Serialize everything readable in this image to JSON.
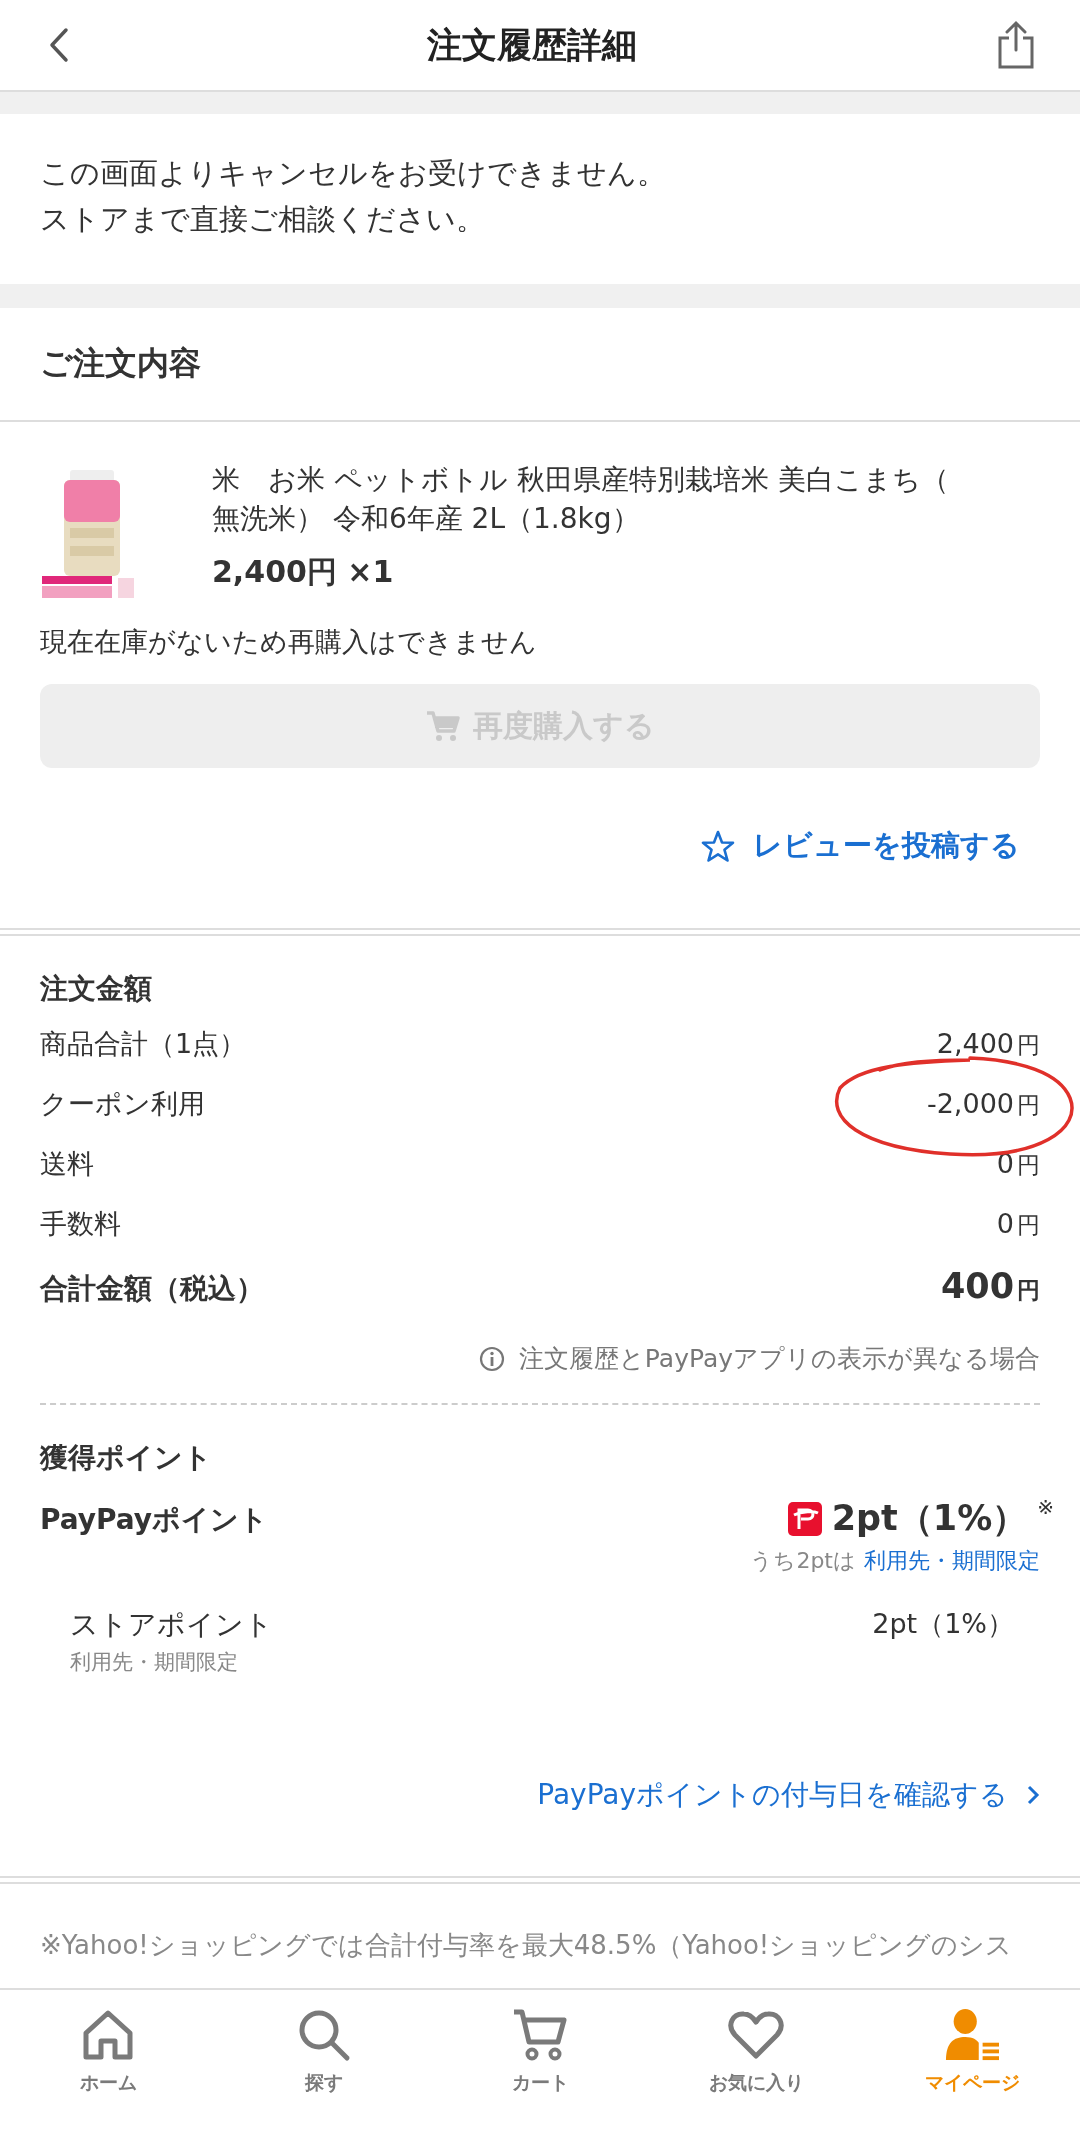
{
  "header": {
    "title": "注文履歴詳細"
  },
  "notice": {
    "lines": [
      "この画面よりキャンセルをお受けできません。",
      "ストアまで直接ご相談ください。"
    ]
  },
  "order": {
    "heading": "ご注文内容",
    "items": [
      {
        "kind": "picture",
        "name": "米　お米 ペットボトル 秋田県産特別栽培米 美白こまち（無洗米） 令和6年産 2L（1.8kg）",
        "price": "2,400円 ×1"
      }
    ],
    "stock_note": "現在在庫がないため再購入はできません",
    "rebuy_button": {
      "label": "再度購入する",
      "disabled": true
    },
    "review_link": "レビューを投稿する"
  },
  "amounts": {
    "heading": "注文金額",
    "rows": [
      {
        "kind": "normal",
        "label": "商品合計（1点）",
        "value": "2,400",
        "unit": "円"
      },
      {
        "kind": "normal",
        "label": "クーポン利用",
        "value": "-2,000",
        "unit": "円"
      },
      {
        "kind": "normal",
        "label": "送料",
        "value": "0",
        "unit": "円"
      },
      {
        "kind": "normal",
        "label": "手数料",
        "value": "0",
        "unit": "円"
      },
      {
        "kind": "total",
        "label": "合計金額（税込）",
        "value": "400",
        "unit": "円"
      }
    ],
    "note": "注文履歴とPayPayアプリの表示が異なる場合"
  },
  "points": {
    "heading": "獲得ポイント",
    "paypay": {
      "label": "PayPayポイント",
      "value": "2pt（1%）",
      "mark": "※",
      "sub_prefix": "うち2ptは",
      "sub_link": "利用先・期間限定"
    },
    "store": {
      "label": "ストアポイント",
      "sub": "利用先・期間限定",
      "value": "2pt（1%）"
    },
    "link": "PayPayポイントの付与日を確認する"
  },
  "footnote": "※Yahoo!ショッピングでは合計付与率を最大48.5%（Yahoo!ショッピングのシス",
  "nav": [
    {
      "kind": "home",
      "label": "ホーム",
      "selected": false
    },
    {
      "kind": "search",
      "label": "探す",
      "selected": false
    },
    {
      "kind": "cart",
      "label": "カート",
      "selected": false
    },
    {
      "kind": "heart",
      "label": "お気に入り",
      "selected": false
    },
    {
      "kind": "user",
      "label": "マイページ",
      "selected": true
    }
  ]
}
